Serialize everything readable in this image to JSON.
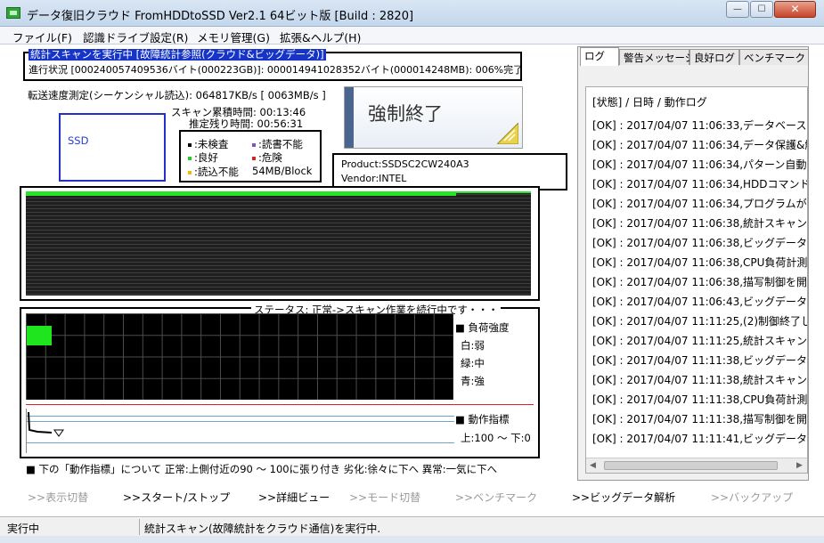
{
  "window": {
    "title": "データ復旧クラウド FromHDDtoSSD Ver2.1 64ビット版 [Build : 2820]",
    "minimize": "—",
    "maximize": "☐",
    "close": "✕"
  },
  "menu": [
    "ファイル(F)",
    "認識ドライブ設定(R)",
    "メモリ管理(G)",
    "拡張&ヘルプ(H)"
  ],
  "status_box": {
    "banner": "統計スキャンを実行中 [故障統計参照(クラウド&ビッグデータ)]",
    "progress": "進行状況 [000240057409536バイト(000223GB)]: 000014941028352バイト(000014248MB): 006%完了"
  },
  "transfer_speed": "転送速度測定(シーケンシャル読込): 064817KB/s [ 0063MB/s ]",
  "scan_time": "スキャン累積時間: 00:13:46",
  "remaining_time": "推定残り時間: 00:56:31",
  "drive_label": "SSD",
  "legend": {
    "unchecked": ":未検査",
    "good": ":良好",
    "read_slow": ":読込不能",
    "read_fail": ":読書不能",
    "danger": ":危険",
    "block_size": "54MB/Block",
    "colors": {
      "unchecked": "#000000",
      "good": "#22cc22",
      "read_slow": "#e8c000",
      "read_fail": "#8a4ccc",
      "danger": "#dd2222"
    }
  },
  "force_stop_button": "強制終了",
  "device": {
    "product": "Product:SSDSC2CW240A3",
    "vendor": "Vendor:INTEL"
  },
  "scan_progress_fraction": 0.06,
  "load_panel": {
    "status_title": "ステータス: 正常->スキャン作業を続行中です・・・",
    "load_title": "負荷強度",
    "load_white": "白:弱",
    "load_green": "緑:中",
    "load_blue": "青:強",
    "indicator_title": "動作指標",
    "indicator_range": "上:100 〜 下:0"
  },
  "bottom_note": "下の「動作指標」について 正常:上側付近の90 〜 100に張り付き 劣化:徐々に下へ 異常:一気に下へ",
  "right_panel": {
    "tabs": [
      "ログ",
      "警告メッセージ",
      "良好ログ",
      "ベンチマーク"
    ],
    "log_header": "[状態] / 日時 / 動作ログ",
    "logs": [
      "[OK] : 2017/04/07 11:06:33,データベース(",
      "[OK] : 2017/04/07 11:06:34,データ保護&解",
      "[OK] : 2017/04/07 11:06:34,パターン自動",
      "[OK] : 2017/04/07 11:06:34,HDDコマンド",
      "[OK] : 2017/04/07 11:06:34,プログラムが",
      "[OK] : 2017/04/07 11:06:38,統計スキャン",
      "[OK] : 2017/04/07 11:06:38,ビッグデータ",
      "[OK] : 2017/04/07 11:06:38,CPU負荷計測",
      "[OK] : 2017/04/07 11:06:38,描写制御を開",
      "[OK] : 2017/04/07 11:06:43,ビッグデータの",
      "[OK] : 2017/04/07 11:11:25,(2)制御終了し",
      "[OK] : 2017/04/07 11:11:25,統計スキャン",
      "[OK] : 2017/04/07 11:11:38,ビッグデータ",
      "[OK] : 2017/04/07 11:11:38,統計スキャン",
      "[OK] : 2017/04/07 11:11:38,CPU負荷計測",
      "[OK] : 2017/04/07 11:11:38,描写制御を開",
      "[OK] : 2017/04/07 11:11:41,ビッグデータの"
    ]
  },
  "actions": [
    ">>表示切替",
    ">>スタート/ストップ",
    ">>詳細ビュー",
    ">>モード切替",
    ">>ベンチマーク",
    ">>ビッグデータ解析",
    ">>バックアップ"
  ],
  "statusbar": {
    "left": "実行中",
    "right": "統計スキャン(故障統計をクラウド通信)を実行中."
  }
}
